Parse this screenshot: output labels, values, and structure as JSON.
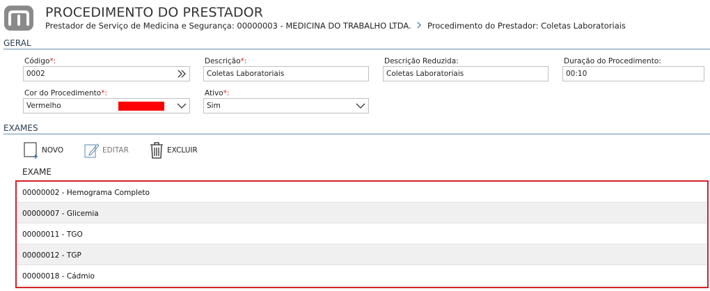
{
  "header": {
    "title": "PROCEDIMENTO DO PRESTADOR",
    "breadcrumb": {
      "parent": "Prestador de Serviço de Medicina e Segurança: 00000003 - MEDICINA DO TRABALHO LTDA.",
      "current": "Procedimento do Prestador: Coletas Laboratoriais"
    }
  },
  "geral": {
    "section_title": "GERAL",
    "codigo": {
      "label": "Código",
      "value": "0002",
      "required": "*:"
    },
    "descricao": {
      "label": "Descrição",
      "value": "Coletas Laboratoriais",
      "required": "*:"
    },
    "descricao_reduzida": {
      "label": "Descrição Reduzida:",
      "value": "Coletas Laboratoriais"
    },
    "duracao": {
      "label": "Duração do Procedimento:",
      "value": "00:10"
    },
    "cor": {
      "label": "Cor do Procedimento",
      "value": "Vermelho",
      "required": "*:",
      "swatch": "#ff0000"
    },
    "ativo": {
      "label": "Ativo",
      "value": "Sim",
      "required": "*:"
    }
  },
  "exames": {
    "section_title": "EXAMES",
    "toolbar": {
      "novo": "NOVO",
      "editar": "EDITAR",
      "excluir": "EXCLUIR"
    },
    "column_header": "EXAME",
    "rows": [
      "00000002 - Hemograma Completo",
      "00000007 - Glicemia",
      "00000011 - TGO",
      "00000012 - TGP",
      "00000018 - Cádmio"
    ]
  },
  "colors": {
    "accent_line": "#5f8fb0",
    "highlight_border": "#d51f27",
    "required": "#d42020"
  },
  "icons": [
    "logo-icon",
    "chevron-right-icon",
    "double-chevron-icon",
    "chevron-down-icon",
    "new-document-icon",
    "edit-icon",
    "trash-icon"
  ]
}
